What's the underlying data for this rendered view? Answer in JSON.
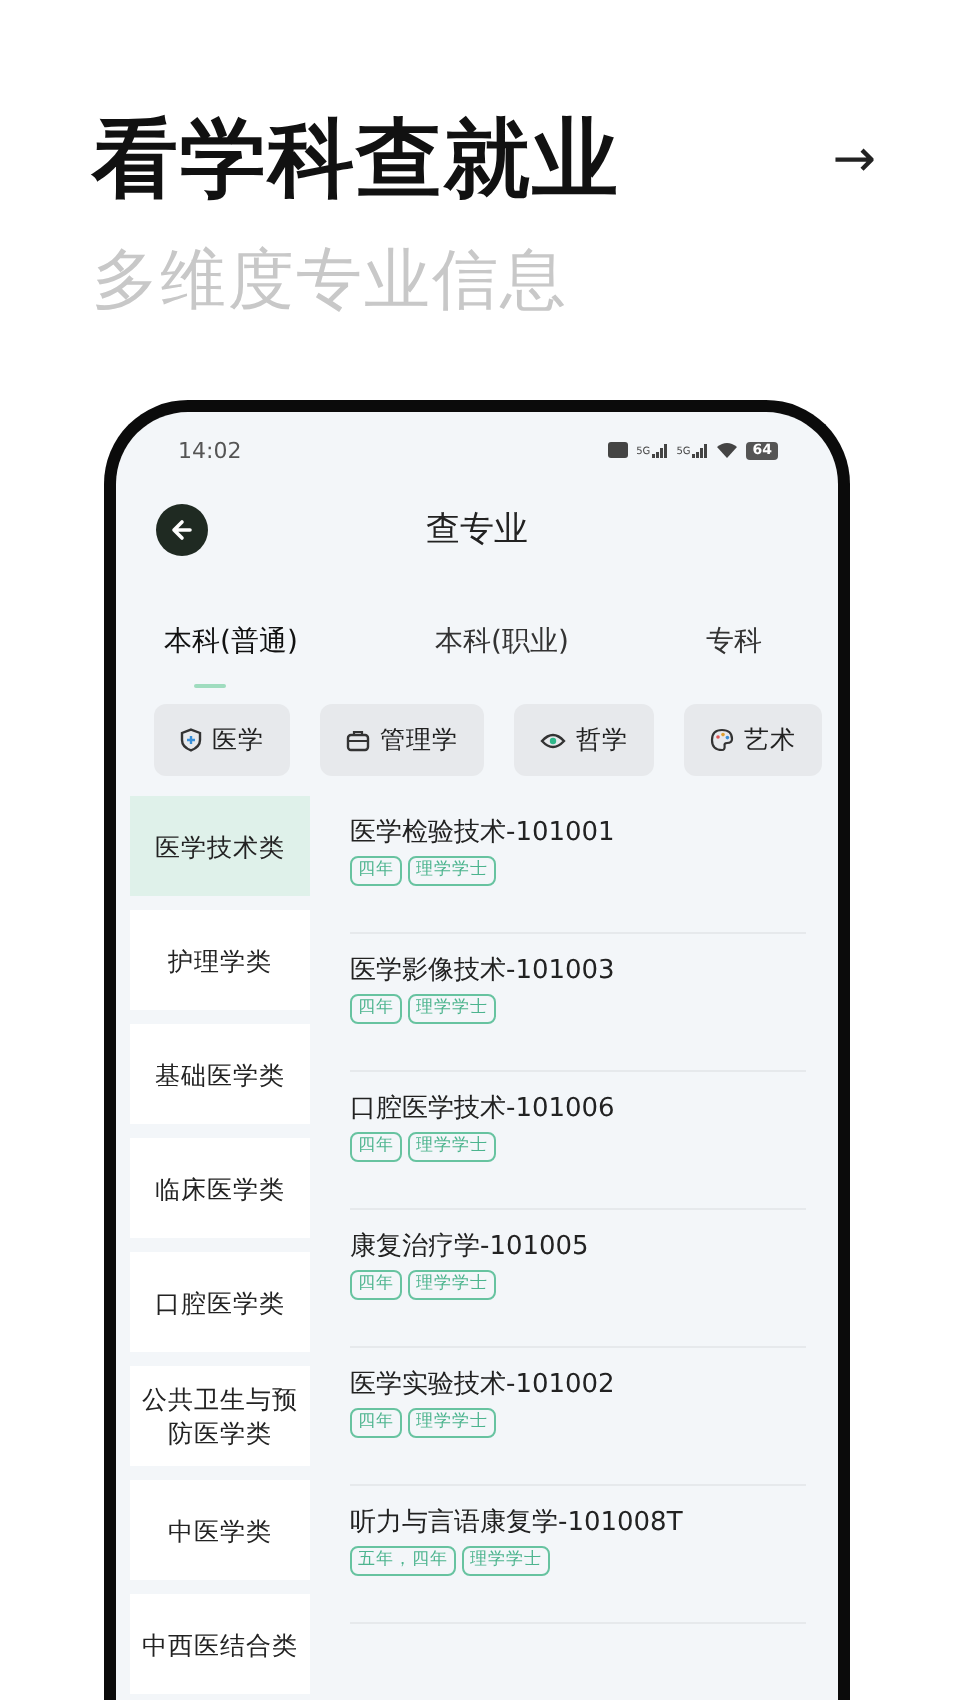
{
  "header": {
    "title": "看学科查就业",
    "arrow": "→",
    "subtitle": "多维度专业信息"
  },
  "status_bar": {
    "time": "14:02",
    "networks": [
      "5G",
      "5G"
    ],
    "battery": "64"
  },
  "nav": {
    "title": "查专业"
  },
  "tabs": [
    {
      "label": "本科(普通)",
      "selected": true
    },
    {
      "label": "本科(职业)",
      "selected": false
    },
    {
      "label": "专科",
      "selected": false
    }
  ],
  "chips": [
    {
      "label": "医学",
      "kind": "shield"
    },
    {
      "label": "管理学",
      "kind": "briefcase"
    },
    {
      "label": "哲学",
      "kind": "eye"
    },
    {
      "label": "艺术",
      "kind": "palette"
    }
  ],
  "categories": [
    {
      "label": "医学技术类",
      "selected": true
    },
    {
      "label": "护理学类",
      "selected": false
    },
    {
      "label": "基础医学类",
      "selected": false
    },
    {
      "label": "临床医学类",
      "selected": false
    },
    {
      "label": "口腔医学类",
      "selected": false
    },
    {
      "label": "公共卫生与预防医学类",
      "selected": false
    },
    {
      "label": "中医学类",
      "selected": false
    },
    {
      "label": "中西医结合类",
      "selected": false
    }
  ],
  "majors": [
    {
      "name": "医学检验技术-101001",
      "tags": [
        "四年",
        "理学学士"
      ]
    },
    {
      "name": "医学影像技术-101003",
      "tags": [
        "四年",
        "理学学士"
      ]
    },
    {
      "name": "口腔医学技术-101006",
      "tags": [
        "四年",
        "理学学士"
      ]
    },
    {
      "name": "康复治疗学-101005",
      "tags": [
        "四年",
        "理学学士"
      ]
    },
    {
      "name": "医学实验技术-101002",
      "tags": [
        "四年",
        "理学学士"
      ]
    },
    {
      "name": "听力与言语康复学-101008T",
      "tags": [
        "五年，四年",
        "理学学士"
      ]
    }
  ]
}
